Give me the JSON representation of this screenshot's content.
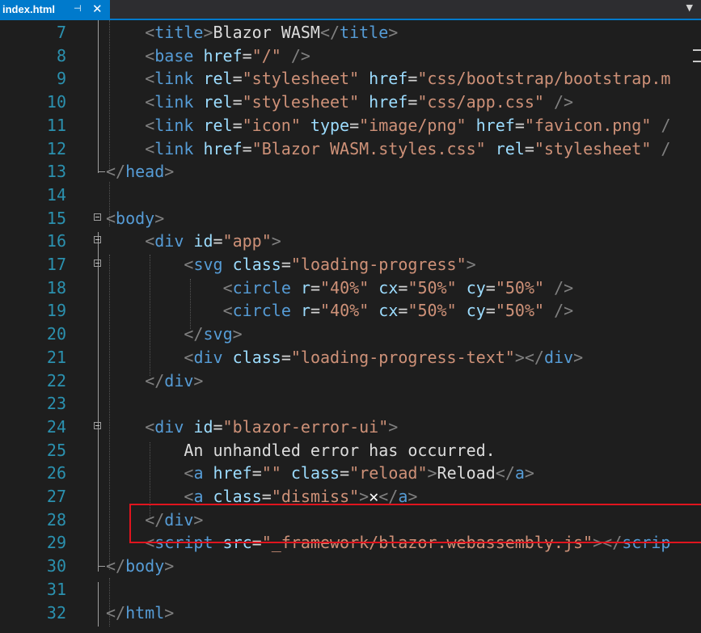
{
  "tab": {
    "label": "index.html",
    "pin_glyph": "⊣",
    "close_glyph": "✕"
  },
  "colors": {
    "accent": "#007acc",
    "highlight_box": "#e0141e"
  },
  "lines": [
    {
      "n": "7",
      "fold": "",
      "indent": 2,
      "tokens": [
        [
          "br",
          "<"
        ],
        [
          "tag",
          "title"
        ],
        [
          "br",
          ">"
        ],
        [
          "txt",
          "Blazor WASM"
        ],
        [
          "br",
          "</"
        ],
        [
          "tag",
          "title"
        ],
        [
          "br",
          ">"
        ]
      ]
    },
    {
      "n": "8",
      "fold": "",
      "indent": 2,
      "tokens": [
        [
          "br",
          "<"
        ],
        [
          "tag",
          "base"
        ],
        [
          "txt",
          " "
        ],
        [
          "attr",
          "href"
        ],
        [
          "eq",
          "="
        ],
        [
          "val",
          "\"/\""
        ],
        [
          "txt",
          " "
        ],
        [
          "br",
          "/>"
        ]
      ]
    },
    {
      "n": "9",
      "fold": "",
      "indent": 2,
      "tokens": [
        [
          "br",
          "<"
        ],
        [
          "tag",
          "link"
        ],
        [
          "txt",
          " "
        ],
        [
          "attr",
          "rel"
        ],
        [
          "eq",
          "="
        ],
        [
          "val",
          "\"stylesheet\""
        ],
        [
          "txt",
          " "
        ],
        [
          "attr",
          "href"
        ],
        [
          "eq",
          "="
        ],
        [
          "val",
          "\"css/bootstrap/bootstrap.m"
        ]
      ]
    },
    {
      "n": "10",
      "fold": "",
      "indent": 2,
      "tokens": [
        [
          "br",
          "<"
        ],
        [
          "tag",
          "link"
        ],
        [
          "txt",
          " "
        ],
        [
          "attr",
          "rel"
        ],
        [
          "eq",
          "="
        ],
        [
          "val",
          "\"stylesheet\""
        ],
        [
          "txt",
          " "
        ],
        [
          "attr",
          "href"
        ],
        [
          "eq",
          "="
        ],
        [
          "val",
          "\"css/app.css\""
        ],
        [
          "txt",
          " "
        ],
        [
          "br",
          "/>"
        ]
      ]
    },
    {
      "n": "11",
      "fold": "",
      "indent": 2,
      "tokens": [
        [
          "br",
          "<"
        ],
        [
          "tag",
          "link"
        ],
        [
          "txt",
          " "
        ],
        [
          "attr",
          "rel"
        ],
        [
          "eq",
          "="
        ],
        [
          "val",
          "\"icon\""
        ],
        [
          "txt",
          " "
        ],
        [
          "attr",
          "type"
        ],
        [
          "eq",
          "="
        ],
        [
          "val",
          "\"image/png\""
        ],
        [
          "txt",
          " "
        ],
        [
          "attr",
          "href"
        ],
        [
          "eq",
          "="
        ],
        [
          "val",
          "\"favicon.png\""
        ],
        [
          "txt",
          " "
        ],
        [
          "br",
          "/"
        ]
      ]
    },
    {
      "n": "12",
      "fold": "",
      "indent": 2,
      "tokens": [
        [
          "br",
          "<"
        ],
        [
          "tag",
          "link"
        ],
        [
          "txt",
          " "
        ],
        [
          "attr",
          "href"
        ],
        [
          "eq",
          "="
        ],
        [
          "val",
          "\"Blazor WASM.styles.css\""
        ],
        [
          "txt",
          " "
        ],
        [
          "attr",
          "rel"
        ],
        [
          "eq",
          "="
        ],
        [
          "val",
          "\"stylesheet\""
        ],
        [
          "txt",
          " "
        ],
        [
          "br",
          "/"
        ]
      ]
    },
    {
      "n": "13",
      "fold": "end",
      "indent": 0,
      "tokens": [
        [
          "br",
          "</"
        ],
        [
          "tag",
          "head"
        ],
        [
          "br",
          ">"
        ]
      ]
    },
    {
      "n": "14",
      "fold": "",
      "indent": 0,
      "tokens": []
    },
    {
      "n": "15",
      "fold": "open",
      "indent": 0,
      "tokens": [
        [
          "br",
          "<"
        ],
        [
          "tag",
          "body"
        ],
        [
          "br",
          ">"
        ]
      ]
    },
    {
      "n": "16",
      "fold": "open",
      "indent": 2,
      "tokens": [
        [
          "br",
          "<"
        ],
        [
          "tag",
          "div"
        ],
        [
          "txt",
          " "
        ],
        [
          "attr",
          "id"
        ],
        [
          "eq",
          "="
        ],
        [
          "val",
          "\"app\""
        ],
        [
          "br",
          ">"
        ]
      ]
    },
    {
      "n": "17",
      "fold": "open",
      "indent": 4,
      "tokens": [
        [
          "br",
          "<"
        ],
        [
          "tag",
          "svg"
        ],
        [
          "txt",
          " "
        ],
        [
          "attr",
          "class"
        ],
        [
          "eq",
          "="
        ],
        [
          "val",
          "\"loading-progress\""
        ],
        [
          "br",
          ">"
        ]
      ]
    },
    {
      "n": "18",
      "fold": "",
      "indent": 6,
      "tokens": [
        [
          "br",
          "<"
        ],
        [
          "tag",
          "circle"
        ],
        [
          "txt",
          " "
        ],
        [
          "attr",
          "r"
        ],
        [
          "eq",
          "="
        ],
        [
          "val",
          "\"40%\""
        ],
        [
          "txt",
          " "
        ],
        [
          "attr",
          "cx"
        ],
        [
          "eq",
          "="
        ],
        [
          "val",
          "\"50%\""
        ],
        [
          "txt",
          " "
        ],
        [
          "attr",
          "cy"
        ],
        [
          "eq",
          "="
        ],
        [
          "val",
          "\"50%\""
        ],
        [
          "txt",
          " "
        ],
        [
          "br",
          "/>"
        ]
      ]
    },
    {
      "n": "19",
      "fold": "",
      "indent": 6,
      "tokens": [
        [
          "br",
          "<"
        ],
        [
          "tag",
          "circle"
        ],
        [
          "txt",
          " "
        ],
        [
          "attr",
          "r"
        ],
        [
          "eq",
          "="
        ],
        [
          "val",
          "\"40%\""
        ],
        [
          "txt",
          " "
        ],
        [
          "attr",
          "cx"
        ],
        [
          "eq",
          "="
        ],
        [
          "val",
          "\"50%\""
        ],
        [
          "txt",
          " "
        ],
        [
          "attr",
          "cy"
        ],
        [
          "eq",
          "="
        ],
        [
          "val",
          "\"50%\""
        ],
        [
          "txt",
          " "
        ],
        [
          "br",
          "/>"
        ]
      ]
    },
    {
      "n": "20",
      "fold": "",
      "indent": 4,
      "tokens": [
        [
          "br",
          "</"
        ],
        [
          "tag",
          "svg"
        ],
        [
          "br",
          ">"
        ]
      ]
    },
    {
      "n": "21",
      "fold": "",
      "indent": 4,
      "tokens": [
        [
          "br",
          "<"
        ],
        [
          "tag",
          "div"
        ],
        [
          "txt",
          " "
        ],
        [
          "attr",
          "class"
        ],
        [
          "eq",
          "="
        ],
        [
          "val",
          "\"loading-progress-text\""
        ],
        [
          "br",
          "></"
        ],
        [
          "tag",
          "div"
        ],
        [
          "br",
          ">"
        ]
      ]
    },
    {
      "n": "22",
      "fold": "",
      "indent": 2,
      "tokens": [
        [
          "br",
          "</"
        ],
        [
          "tag",
          "div"
        ],
        [
          "br",
          ">"
        ]
      ]
    },
    {
      "n": "23",
      "fold": "",
      "indent": 0,
      "tokens": []
    },
    {
      "n": "24",
      "fold": "open",
      "indent": 2,
      "tokens": [
        [
          "br",
          "<"
        ],
        [
          "tag",
          "div"
        ],
        [
          "txt",
          " "
        ],
        [
          "attr",
          "id"
        ],
        [
          "eq",
          "="
        ],
        [
          "val",
          "\"blazor-error-ui\""
        ],
        [
          "br",
          ">"
        ]
      ]
    },
    {
      "n": "25",
      "fold": "",
      "indent": 4,
      "tokens": [
        [
          "txt",
          "An unhandled error has occurred."
        ]
      ]
    },
    {
      "n": "26",
      "fold": "",
      "indent": 4,
      "tokens": [
        [
          "br",
          "<"
        ],
        [
          "tag",
          "a"
        ],
        [
          "txt",
          " "
        ],
        [
          "attr",
          "href"
        ],
        [
          "eq",
          "="
        ],
        [
          "val",
          "\"\""
        ],
        [
          "txt",
          " "
        ],
        [
          "attr",
          "class"
        ],
        [
          "eq",
          "="
        ],
        [
          "val",
          "\"reload\""
        ],
        [
          "br",
          ">"
        ],
        [
          "txt",
          "Reload"
        ],
        [
          "br",
          "</"
        ],
        [
          "tag",
          "a"
        ],
        [
          "br",
          ">"
        ]
      ]
    },
    {
      "n": "27",
      "fold": "",
      "indent": 4,
      "tokens": [
        [
          "br",
          "<"
        ],
        [
          "tag",
          "a"
        ],
        [
          "txt",
          " "
        ],
        [
          "attr",
          "class"
        ],
        [
          "eq",
          "="
        ],
        [
          "val",
          "\"dismiss\""
        ],
        [
          "br",
          ">"
        ],
        [
          "x",
          "✕"
        ],
        [
          "br",
          "</"
        ],
        [
          "tag",
          "a"
        ],
        [
          "br",
          ">"
        ]
      ]
    },
    {
      "n": "28",
      "fold": "",
      "indent": 2,
      "tokens": [
        [
          "br",
          "</"
        ],
        [
          "tag",
          "div"
        ],
        [
          "br",
          ">"
        ]
      ]
    },
    {
      "n": "29",
      "fold": "",
      "indent": 2,
      "tokens": [
        [
          "br",
          "<"
        ],
        [
          "tag",
          "script"
        ],
        [
          "txt",
          " "
        ],
        [
          "attr",
          "src"
        ],
        [
          "eq",
          "="
        ],
        [
          "val",
          "\"_framework/blazor.webassembly.js\""
        ],
        [
          "br",
          "></"
        ],
        [
          "tag",
          "scrip"
        ]
      ]
    },
    {
      "n": "30",
      "fold": "end",
      "indent": 0,
      "tokens": [
        [
          "br",
          "</"
        ],
        [
          "tag",
          "body"
        ],
        [
          "br",
          ">"
        ]
      ]
    },
    {
      "n": "31",
      "fold": "",
      "indent": 0,
      "tokens": []
    },
    {
      "n": "32",
      "fold": "",
      "indent": 0,
      "tokens": [
        [
          "br",
          "</"
        ],
        [
          "tag",
          "html"
        ],
        [
          "br",
          ">"
        ]
      ]
    }
  ]
}
